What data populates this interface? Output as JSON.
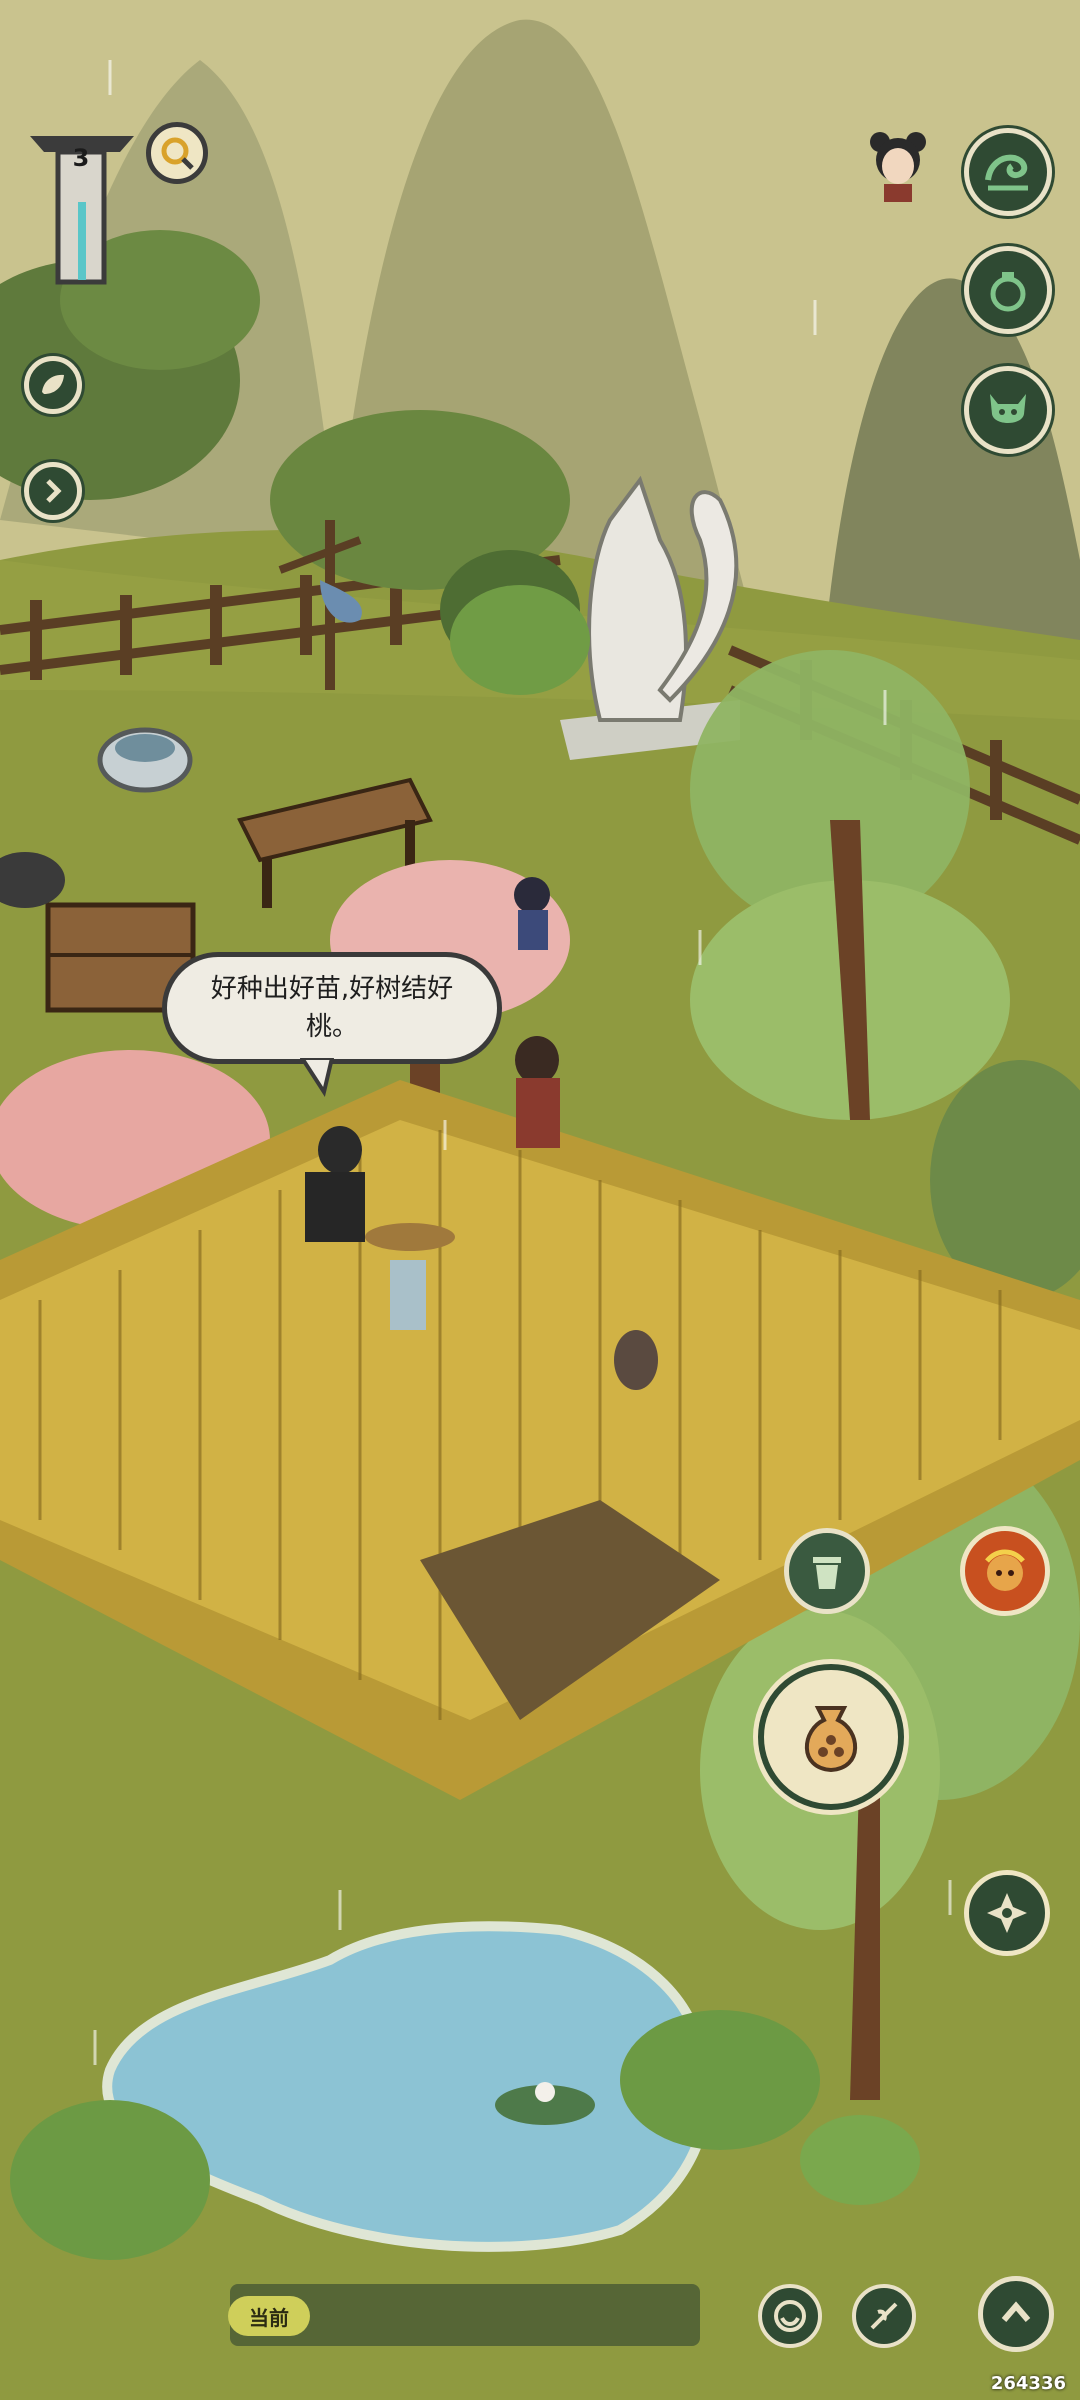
{
  "hud": {
    "level_number": "3",
    "speech_bubble_text": "好种出好苗,好树结好桃。",
    "current_label": "当前",
    "watermark_id": "264336"
  },
  "icons": {
    "top_right": [
      "wave-icon",
      "gourd-icon",
      "demon-mask-icon"
    ],
    "left_side": [
      "leaf-icon",
      "chevron-right-icon"
    ],
    "right_middle": [
      "trash-bin-icon",
      "monkey-king-icon",
      "seed-bag-icon",
      "shuriken-icon"
    ],
    "bottom": [
      "smile-icon",
      "sprout-icon",
      "chevron-up-icon"
    ]
  },
  "colors": {
    "button_dark": "#2f4a33",
    "button_border": "#e9e2c7",
    "grass": "#8e9a3d",
    "wheat": "#c8a83a",
    "pond": "#8fc4d6"
  }
}
